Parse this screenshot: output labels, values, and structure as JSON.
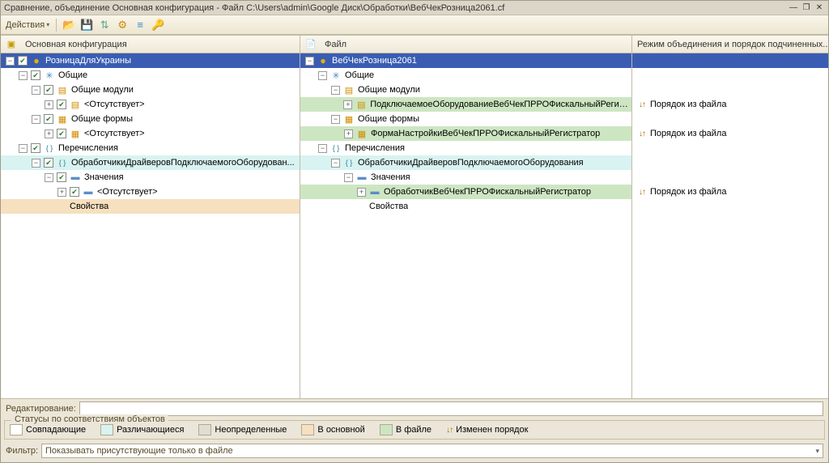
{
  "title": "Сравнение, объединение Основная конфигурация - Файл C:\\Users\\admin\\Google Диск\\Обработки\\ВебЧекРозница2061.cf",
  "toolbar": {
    "actions": "Действия"
  },
  "columns": {
    "col1": "Основная конфигурация",
    "col2": "Файл",
    "col3": "Режим объединения и порядок подчиненных..."
  },
  "left": [
    {
      "indent": 0,
      "toggle": "-",
      "chk": true,
      "icon": "globe",
      "label": "РозницаДляУкраины",
      "cls": "sel"
    },
    {
      "indent": 1,
      "toggle": "-",
      "chk": true,
      "icon": "star",
      "label": "Общие"
    },
    {
      "indent": 2,
      "toggle": "-",
      "chk": true,
      "icon": "mod",
      "label": "Общие модули"
    },
    {
      "indent": 3,
      "toggle": "+",
      "chk": true,
      "icon": "mod",
      "label": "<Отсутствует>"
    },
    {
      "indent": 2,
      "toggle": "-",
      "chk": true,
      "icon": "form",
      "label": "Общие формы"
    },
    {
      "indent": 3,
      "toggle": "+",
      "chk": true,
      "icon": "form",
      "label": "<Отсутствует>"
    },
    {
      "indent": 1,
      "toggle": "-",
      "chk": true,
      "icon": "brace",
      "label": "Перечисления"
    },
    {
      "indent": 2,
      "toggle": "-",
      "chk": true,
      "icon": "brace",
      "label": "ОбработчикиДрайверовПодключаемогоОборудован...",
      "cls": "hl-cyan"
    },
    {
      "indent": 3,
      "toggle": "-",
      "chk": true,
      "icon": "item",
      "label": "Значения"
    },
    {
      "indent": 4,
      "toggle": "+",
      "chk": true,
      "icon": "item",
      "label": "<Отсутствует>"
    },
    {
      "indent": 4,
      "toggle": "",
      "chk": false,
      "icon": "",
      "label": "Свойства",
      "cls": "hl-orange",
      "plain": true
    }
  ],
  "right": [
    {
      "indent": 0,
      "toggle": "-",
      "icon": "globe",
      "label": "ВебЧекРозница2061",
      "cls": "sel"
    },
    {
      "indent": 1,
      "toggle": "-",
      "icon": "star",
      "label": "Общие"
    },
    {
      "indent": 2,
      "toggle": "-",
      "icon": "mod",
      "label": "Общие модули"
    },
    {
      "indent": 3,
      "toggle": "+",
      "icon": "mod",
      "label": "ПодключаемоеОборудованиеВебЧекПРРОФискальныйРегис...",
      "cls": "hl-green"
    },
    {
      "indent": 2,
      "toggle": "-",
      "icon": "form",
      "label": "Общие формы"
    },
    {
      "indent": 3,
      "toggle": "+",
      "icon": "form",
      "label": "ФормаНастройкиВебЧекПРРОФискальныйРегистратор",
      "cls": "hl-green"
    },
    {
      "indent": 1,
      "toggle": "-",
      "icon": "brace",
      "label": "Перечисления"
    },
    {
      "indent": 2,
      "toggle": "-",
      "icon": "brace",
      "label": "ОбработчикиДрайверовПодключаемогоОборудования",
      "cls": "hl-cyan"
    },
    {
      "indent": 3,
      "toggle": "-",
      "icon": "item",
      "label": "Значения"
    },
    {
      "indent": 4,
      "toggle": "+",
      "icon": "item",
      "label": "ОбработчикВебЧекПРРОФискальныйРегистратор",
      "cls": "hl-green"
    },
    {
      "indent": 4,
      "toggle": "",
      "icon": "",
      "label": "Свойства",
      "plain": true
    }
  ],
  "orders": [
    "",
    "",
    "",
    "Порядок из файла",
    "",
    "Порядок из файла",
    "",
    "",
    "",
    "Порядок из файла",
    ""
  ],
  "edit": {
    "label": "Редактирование:"
  },
  "legend": {
    "title": "Статусы по соответствиям объектов",
    "items": [
      "Совпадающие",
      "Различающиеся",
      "Неопределенные",
      "В основной",
      "В файле",
      "Изменен порядок"
    ]
  },
  "filter": {
    "label": "Фильтр:",
    "value": "Показывать присутствующие только в файле"
  }
}
